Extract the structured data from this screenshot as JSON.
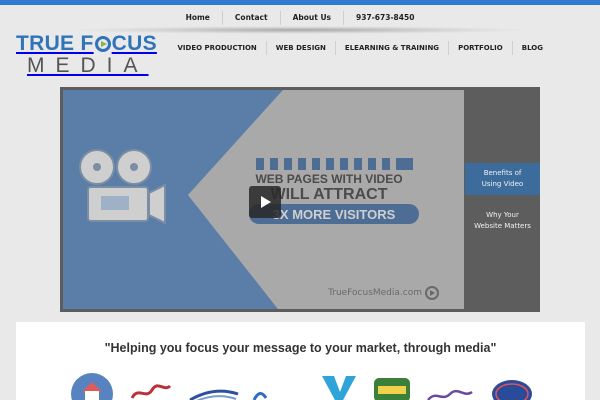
{
  "colors": {
    "top_bar": "#2e7bd0",
    "brand_blue": "#2f74b8",
    "active_tab": "#3c6c9c",
    "page_bg": "#e9e9e9"
  },
  "utility_nav": [
    {
      "label": "Home"
    },
    {
      "label": "Contact"
    },
    {
      "label": "About Us"
    },
    {
      "label": "937-673-8450"
    }
  ],
  "logo": {
    "line1_a": "TRUE F",
    "line1_b": "CUS",
    "line2": "MEDIA"
  },
  "main_nav": [
    {
      "label": "VIDEO PRODUCTION"
    },
    {
      "label": "WEB DESIGN"
    },
    {
      "label": "ELEARNING & TRAINING"
    },
    {
      "label": "PORTFOLIO"
    },
    {
      "label": "BLOG"
    }
  ],
  "hero": {
    "video": {
      "banner_line1": "WEB PAGES WITH VIDEO",
      "banner_line2": "WILL ATTRACT",
      "banner_line3": "3X MORE VISITORS",
      "watermark": "TrueFocusMedia.com",
      "play_icon": "play-icon"
    },
    "side_items": [
      {
        "line1": "Benefits of",
        "line2": "Using Video",
        "active": true
      },
      {
        "line1": "Why Your",
        "line2": "Website Matters",
        "active": false
      }
    ]
  },
  "content": {
    "tagline": "\"Helping you focus your message to your market, through media\""
  },
  "client_logos": [
    {
      "icon": "house-logo-icon",
      "color": "#3a6fb5"
    },
    {
      "icon": "script-logo-icon",
      "color": "#b8323a"
    },
    {
      "icon": "swoosh-logo-icon",
      "color": "#2d4f9e"
    },
    {
      "icon": "wave-logo-icon",
      "color": "#2c6fc0"
    },
    {
      "icon": "v-logo-icon",
      "color": "#2fa4d9"
    },
    {
      "icon": "final-logo-icon",
      "color": "#3a7f3a"
    },
    {
      "icon": "scribble-logo-icon",
      "color": "#6a4aa0"
    },
    {
      "icon": "oval-logo-icon",
      "color": "#2a4a9a"
    }
  ]
}
